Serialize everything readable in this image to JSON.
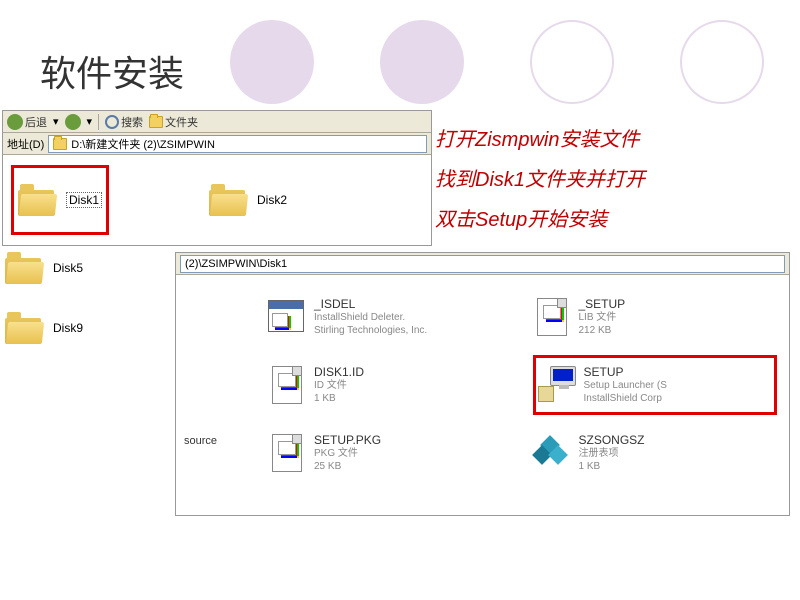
{
  "title": "软件安装",
  "instructions": {
    "line1_a": "打开",
    "line1_b": "Zismpwin",
    "line1_c": "安装文件",
    "line2_a": "找到",
    "line2_b": "Disk1",
    "line2_c": "文件夹并打开",
    "line3_a": "双击",
    "line3_b": "Setup",
    "line3_c": "开始安装"
  },
  "explorer1": {
    "back": "后退",
    "search": "搜索",
    "folders": "文件夹",
    "address_label": "地址(D)",
    "path": "D:\\新建文件夹 (2)\\ZSIMPWIN",
    "disk1": "Disk1",
    "disk2": "Disk2"
  },
  "left": {
    "disk5": "Disk5",
    "disk9": "Disk9"
  },
  "explorer2": {
    "path": "(2)\\ZSIMPWIN\\Disk1",
    "source": "source",
    "files": {
      "isdel": {
        "name": "_ISDEL",
        "sub1": "InstallShield Deleter.",
        "sub2": "Stirling Technologies, Inc."
      },
      "setup_lib": {
        "name": "_SETUP",
        "sub1": "LIB 文件",
        "sub2": "212 KB"
      },
      "disk1id": {
        "name": "DISK1.ID",
        "sub1": "ID 文件",
        "sub2": "1 KB"
      },
      "setup": {
        "name": "SETUP",
        "sub1": "Setup Launcher (S",
        "sub2": "InstallShield Corp"
      },
      "setuppkg": {
        "name": "SETUP.PKG",
        "sub1": "PKG 文件",
        "sub2": "25 KB"
      },
      "szsongsz": {
        "name": "SZSONGSZ",
        "sub1": "注册表项",
        "sub2": "1 KB"
      }
    }
  }
}
